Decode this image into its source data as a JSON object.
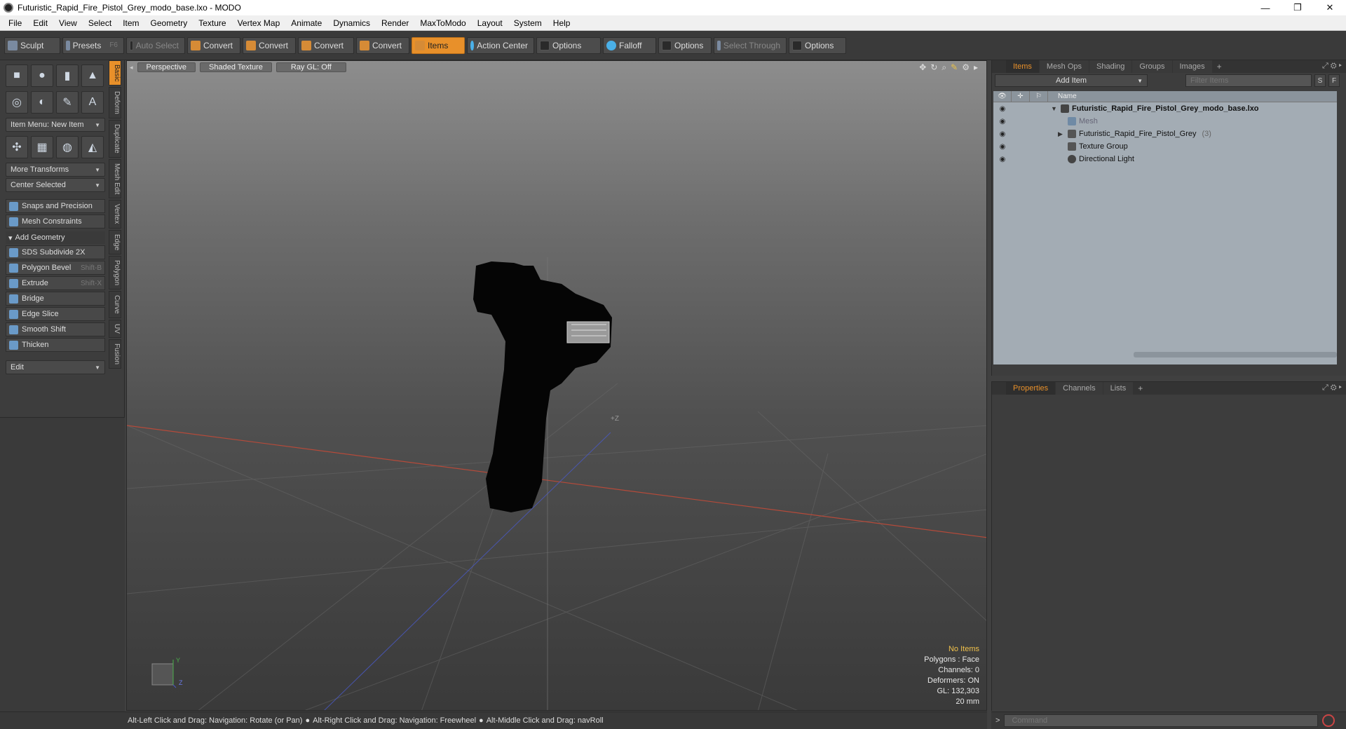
{
  "window": {
    "title": "Futuristic_Rapid_Fire_Pistol_Grey_modo_base.lxo - MODO",
    "minimize": "—",
    "restore": "❐",
    "close": "✕"
  },
  "menu": [
    "File",
    "Edit",
    "View",
    "Select",
    "Item",
    "Geometry",
    "Texture",
    "Vertex Map",
    "Animate",
    "Dynamics",
    "Render",
    "MaxToModo",
    "Layout",
    "System",
    "Help"
  ],
  "toolbar": {
    "sculpt": "Sculpt",
    "presets": "Presets",
    "presets_key": "F6",
    "auto_select": "Auto Select",
    "convert1": "Convert",
    "convert2": "Convert",
    "convert3": "Convert",
    "convert4": "Convert",
    "items": "Items",
    "action_center": "Action Center",
    "options1": "Options",
    "falloff": "Falloff",
    "options2": "Options",
    "select_through": "Select Through",
    "options3": "Options"
  },
  "left": {
    "item_menu": "Item Menu: New Item",
    "more_transforms": "More Transforms",
    "center_selected": "Center Selected",
    "snaps": "Snaps and Precision",
    "mesh_constraints": "Mesh Constraints",
    "add_geometry": "Add Geometry",
    "tools": [
      {
        "label": "SDS Subdivide 2X",
        "key": ""
      },
      {
        "label": "Polygon Bevel",
        "key": "Shift-B"
      },
      {
        "label": "Extrude",
        "key": "Shift-X"
      },
      {
        "label": "Bridge",
        "key": ""
      },
      {
        "label": "Edge Slice",
        "key": ""
      },
      {
        "label": "Smooth Shift",
        "key": ""
      },
      {
        "label": "Thicken",
        "key": ""
      }
    ],
    "edit": "Edit",
    "vtabs": [
      "Basic",
      "Deform",
      "Duplicate",
      "Mesh Edit",
      "Vertex",
      "Edge",
      "Polygon",
      "Curve",
      "UV",
      "Fusion"
    ]
  },
  "viewport": {
    "perspective": "Perspective",
    "shaded_texture": "Shaded Texture",
    "raygl": "Ray GL: Off",
    "axis_label": "+Z",
    "info": {
      "no_items": "No Items",
      "polygons": "Polygons : Face",
      "channels": "Channels: 0",
      "deformers": "Deformers: ON",
      "gl": "GL: 132,303",
      "scale": "20 mm"
    },
    "gizmo_y": "Y",
    "gizmo_z": "Z"
  },
  "items_panel": {
    "tabs": [
      "Items",
      "Mesh Ops",
      "Shading",
      "Groups",
      "Images"
    ],
    "add_item": "Add Item",
    "filter_placeholder": "Filter Items",
    "btn_s": "S",
    "btn_f": "F",
    "col_name": "Name",
    "rows": [
      {
        "label": "Futuristic_Rapid_Fire_Pistol_Grey_modo_base.lxo",
        "count": ""
      },
      {
        "label": "Mesh",
        "count": ""
      },
      {
        "label": "Futuristic_Rapid_Fire_Pistol_Grey",
        "count": "(3)"
      },
      {
        "label": "Texture Group",
        "count": ""
      },
      {
        "label": "Directional Light",
        "count": ""
      }
    ]
  },
  "props_panel": {
    "tabs": [
      "Properties",
      "Channels",
      "Lists"
    ]
  },
  "status": {
    "hint1": "Alt-Left Click and Drag: Navigation: Rotate (or Pan)",
    "hint2": "Alt-Right Click and Drag: Navigation: Freewheel",
    "hint3": "Alt-Middle Click and Drag: navRoll"
  },
  "command": {
    "prompt": ">",
    "placeholder": "Command"
  }
}
